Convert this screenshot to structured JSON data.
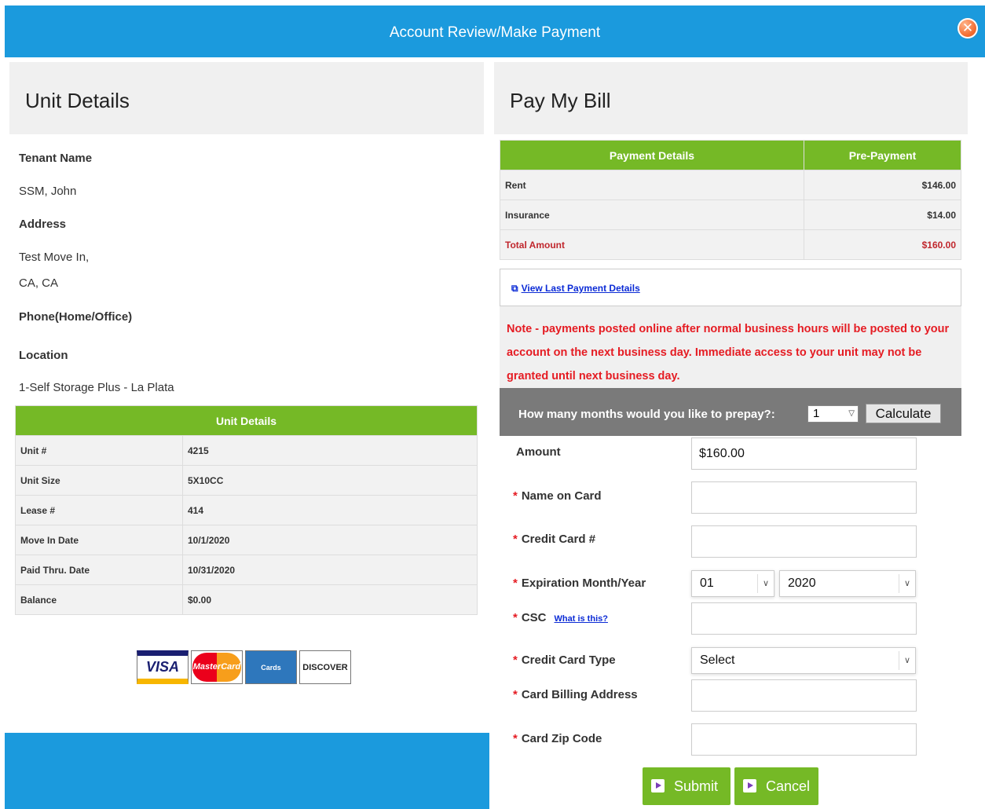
{
  "window": {
    "title": "Account Review/Make Payment"
  },
  "left": {
    "heading": "Unit Details",
    "tenant_label": "Tenant Name",
    "tenant_value": "SSM, John",
    "address_label": "Address",
    "address_line1": "Test Move In,",
    "address_line2": "CA, CA",
    "phone_label": "Phone(Home/Office)",
    "location_label": "Location",
    "location_value": "1-Self Storage Plus - La Plata",
    "table_title": "Unit Details",
    "rows": [
      {
        "label": "Unit #",
        "value": "4215"
      },
      {
        "label": "Unit Size",
        "value": "5X10CC"
      },
      {
        "label": "Lease #",
        "value": "414"
      },
      {
        "label": "Move In Date",
        "value": "10/1/2020"
      },
      {
        "label": "Paid Thru. Date",
        "value": "10/31/2020"
      },
      {
        "label": "Balance",
        "value": "$0.00"
      }
    ],
    "cards": [
      "VISA",
      "MasterCard",
      "Cards",
      "DISCOVER"
    ]
  },
  "right": {
    "heading": "Pay My Bill",
    "col1": "Payment Details",
    "col2": "Pre-Payment",
    "rows": [
      {
        "label": "Rent",
        "value": "$146.00"
      },
      {
        "label": "Insurance",
        "value": "$14.00"
      },
      {
        "label": "Total Amount",
        "value": "$160.00"
      }
    ],
    "last_payment_link": "View Last Payment Details",
    "note": "Note - payments posted online after normal business hours will be posted to your account on the next business day. Immediate access to your unit may not be granted until next business day.",
    "prepay_question": "How many months would you like to prepay?:",
    "prepay_months": "1",
    "calculate_label": "Calculate"
  },
  "form": {
    "amount_label": "Amount",
    "amount_value": "$160.00",
    "name_label": "Name on  Card",
    "cc_label": "Credit Card #",
    "exp_label": "Expiration Month/Year",
    "exp_month": "01",
    "exp_year": "2020",
    "csc_label": "CSC",
    "csc_help": "What is this?",
    "type_label": "Credit Card Type",
    "type_value": "Select",
    "billing_label": "Card Billing Address",
    "zip_label": "Card Zip Code",
    "required_mark": "*",
    "submit_label": "Submit",
    "cancel_label": "Cancel"
  },
  "colors": {
    "header_blue": "#1b9add",
    "green": "#75b926",
    "note_red": "#e51c23"
  }
}
